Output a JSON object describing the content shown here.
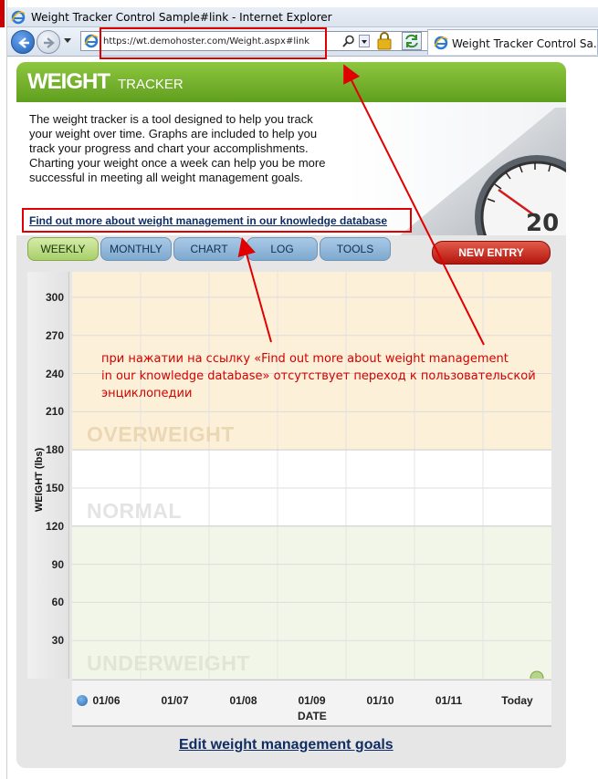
{
  "window": {
    "title": "Weight Tracker Control Sample#link - Internet Explorer"
  },
  "browser": {
    "url": "https://wt.demohoster.com/Weight.aspx#link",
    "tab_title": "Weight Tracker Control Sa..."
  },
  "header": {
    "brand_main": "WEIGHT",
    "brand_sub": "TRACKER"
  },
  "intro": {
    "text": "The weight tracker is a tool designed to help you track your weight over time. Graphs are included to help you track your progress and chart your accomplishments. Charting your weight once a week can help you be more successful in meeting all weight management goals.",
    "link": "Find out more about weight management in our knowledge database"
  },
  "tabs": [
    {
      "label": "WEEKLY",
      "active": true
    },
    {
      "label": "MONTHLY",
      "active": false
    },
    {
      "label": "CHART",
      "active": false
    },
    {
      "label": "LOG",
      "active": false
    },
    {
      "label": "TOOLS",
      "active": false
    }
  ],
  "new_entry_label": "NEW ENTRY",
  "chart_data": {
    "type": "line",
    "ylabel": "WEIGHT (lbs)",
    "xlabel": "DATE",
    "y_ticks": [
      300,
      270,
      240,
      210,
      180,
      150,
      120,
      90,
      60,
      30
    ],
    "ylim": [
      0,
      320
    ],
    "categories": [
      "01/06",
      "01/07",
      "01/08",
      "01/09",
      "01/10",
      "01/11",
      "Today"
    ],
    "series": [],
    "zones": [
      {
        "label": "OVERWEIGHT",
        "from": 180,
        "to": 320,
        "color": "#fdf0d8"
      },
      {
        "label": "NORMAL",
        "from": 120,
        "to": 180,
        "color": "#ffffff"
      },
      {
        "label": "UNDERWEIGHT",
        "from": 0,
        "to": 120,
        "color": "#f2f6e8"
      }
    ],
    "grid": true
  },
  "footer": {
    "edit_goals": "Edit weight management goals"
  },
  "annotation": {
    "line1": "при нажатии на ссылку «Find out more about weight management",
    "line2": "in our knowledge database» отсутствует переход к пользовательской",
    "line3": "энциклопедии",
    "color": "#e00000"
  },
  "colors": {
    "brand_green": "#7ab62e",
    "tab_blue": "#8fb5d9",
    "tab_active_green": "#bddf8a",
    "new_entry_red": "#c8281c",
    "link_navy": "#0f2d63"
  }
}
